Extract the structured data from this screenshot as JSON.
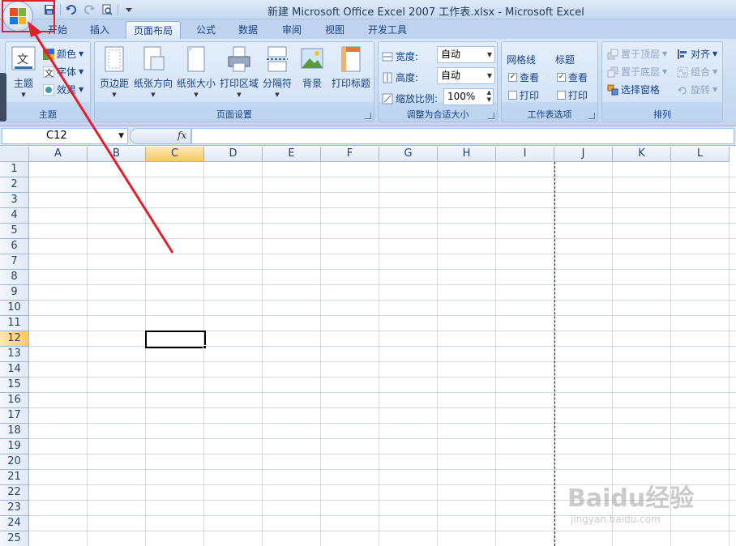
{
  "window": {
    "title": "新建 Microsoft Office Excel 2007 工作表.xlsx - Microsoft Excel"
  },
  "quick_access": {
    "items": [
      "save-icon",
      "undo-icon",
      "redo-icon",
      "print-preview-icon",
      "customize-icon"
    ]
  },
  "tabs": [
    {
      "label": "开始",
      "active": false
    },
    {
      "label": "插入",
      "active": false
    },
    {
      "label": "页面布局",
      "active": true
    },
    {
      "label": "公式",
      "active": false
    },
    {
      "label": "数据",
      "active": false
    },
    {
      "label": "审阅",
      "active": false
    },
    {
      "label": "视图",
      "active": false
    },
    {
      "label": "开发工具",
      "active": false
    }
  ],
  "ribbon": {
    "theme_group": {
      "label": "主题",
      "theme_button": "主题",
      "colors": "颜色",
      "fonts": "字体",
      "effects": "效果"
    },
    "page_setup_group": {
      "label": "页面设置",
      "margins": "页边距",
      "orientation": "纸张方向",
      "size": "纸张大小",
      "print_area": "打印区域",
      "breaks": "分隔符",
      "background": "背景",
      "print_titles": "打印标题"
    },
    "scale_group": {
      "label": "调整为合适大小",
      "width_label": "宽度:",
      "width_value": "自动",
      "height_label": "高度:",
      "height_value": "自动",
      "scale_label": "缩放比例:",
      "scale_value": "100%"
    },
    "sheet_options_group": {
      "label": "工作表选项",
      "gridlines": "网格线",
      "headings": "标题",
      "view": "查看",
      "print": "打印"
    },
    "arrange_group": {
      "label": "排列",
      "bring_front": "置于顶层",
      "send_back": "置于底层",
      "selection_pane": "选择窗格",
      "align": "对齐",
      "group": "组合",
      "rotate": "旋转"
    }
  },
  "formula_bar": {
    "name_box": "C12",
    "fx": "fx"
  },
  "sheet": {
    "columns": [
      "A",
      "B",
      "C",
      "D",
      "E",
      "F",
      "G",
      "H",
      "I",
      "J",
      "K",
      "L"
    ],
    "rows": [
      "1",
      "2",
      "3",
      "4",
      "5",
      "6",
      "7",
      "8",
      "9",
      "10",
      "11",
      "12",
      "13",
      "14",
      "15",
      "16",
      "17",
      "18",
      "19",
      "20",
      "21",
      "22",
      "23",
      "24",
      "25"
    ],
    "selected_column": "C",
    "selected_row": "12"
  },
  "watermark": {
    "main": "Baidu经验",
    "sub": "jingyan.baidu.com"
  },
  "colors": {
    "annotation_red": "#e0202a",
    "selection_orange": "#f9c86a"
  }
}
